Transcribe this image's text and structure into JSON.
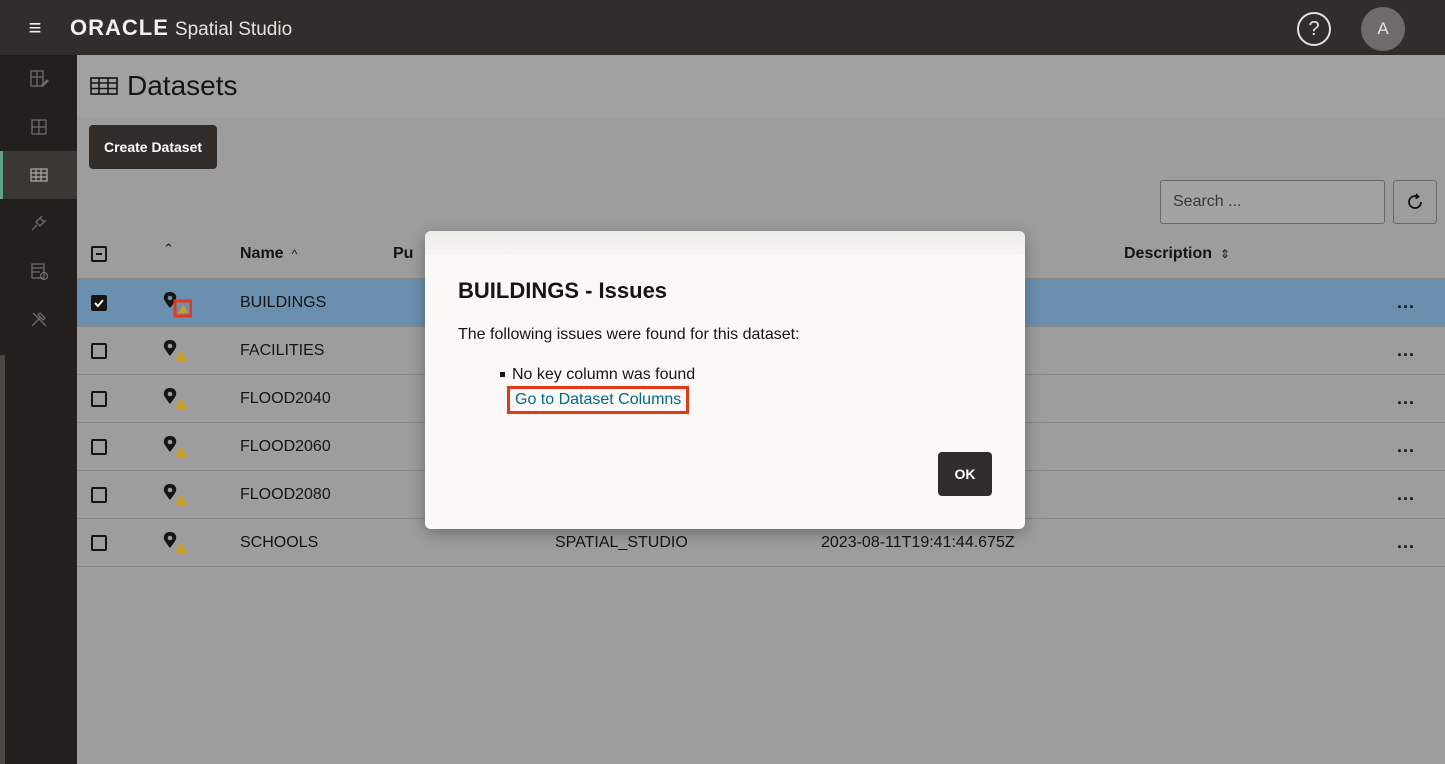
{
  "header": {
    "brand_oracle": "ORACLE",
    "brand_product": "Spatial Studio",
    "help_label": "?",
    "avatar_initial": "A"
  },
  "sidebar": {
    "items": [
      {
        "icon": "edit-project-icon",
        "active": false
      },
      {
        "icon": "projects-icon",
        "active": false
      },
      {
        "icon": "datasets-icon",
        "active": true
      },
      {
        "icon": "connections-icon",
        "active": false
      },
      {
        "icon": "jobs-icon",
        "active": false
      },
      {
        "icon": "tools-icon",
        "active": false
      }
    ]
  },
  "page": {
    "title": "Datasets",
    "create_button": "Create Dataset",
    "search_placeholder": "Search ..."
  },
  "table": {
    "columns": {
      "name": "Name",
      "published": "Pu",
      "description": "Description"
    },
    "rows": [
      {
        "name": "BUILDINGS",
        "published": "",
        "date": "",
        "checked": true
      },
      {
        "name": "FACILITIES",
        "published": "",
        "date": "",
        "checked": false
      },
      {
        "name": "FLOOD2040",
        "published": "",
        "date": "",
        "checked": false
      },
      {
        "name": "FLOOD2060",
        "published": "",
        "date": "",
        "checked": false
      },
      {
        "name": "FLOOD2080",
        "published": "",
        "date": "",
        "checked": false
      },
      {
        "name": "SCHOOLS",
        "published": "SPATIAL_STUDIO",
        "date": "2023-08-11T19:41:44.675Z",
        "checked": false
      }
    ],
    "more_label": "..."
  },
  "modal": {
    "title": "BUILDINGS - Issues",
    "body": "The following issues were found for this dataset:",
    "issue": "No key column was found",
    "link": "Go to Dataset Columns",
    "ok_button": "OK"
  },
  "colors": {
    "accent_active": "#5fa38a",
    "highlight": "#e2391b",
    "link": "#00688c",
    "selected_row": "#6b8faf",
    "warning": "#c99a2e"
  }
}
